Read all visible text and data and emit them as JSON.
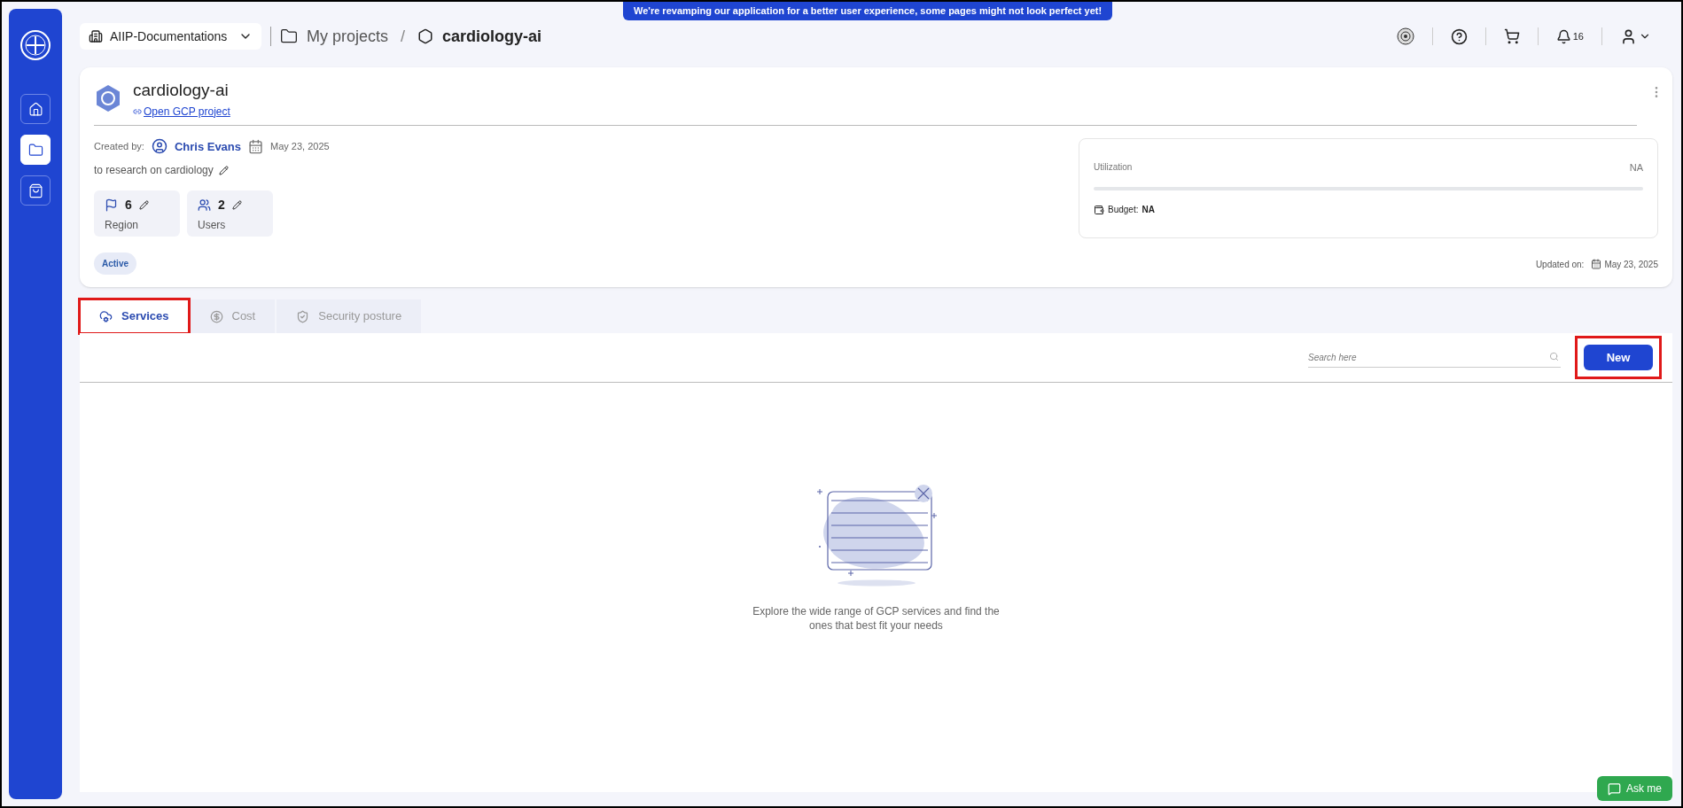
{
  "banner": "We're revamping our application for a better user experience, some pages might not look perfect yet!",
  "sidebar": {
    "items": [
      {
        "kind": "home",
        "selected": false
      },
      {
        "kind": "folder",
        "selected": true
      },
      {
        "kind": "bag",
        "selected": false
      }
    ]
  },
  "topbar": {
    "workspace": "AIIP-Documentations",
    "breadcrumb": [
      "My projects",
      "cardiology-ai"
    ],
    "separator": "/",
    "notifications": "16"
  },
  "project": {
    "name": "cardiology-ai",
    "link": "Open GCP project",
    "created_by_label": "Created by:",
    "creator": "Chris Evans",
    "created_on": "May 23, 2025",
    "description": "to research on cardiology",
    "stats": [
      {
        "kind": "region",
        "value": "6",
        "label": "Region"
      },
      {
        "kind": "users",
        "value": "2",
        "label": "Users"
      }
    ],
    "status": "Active",
    "utilization": {
      "label": "Utilization",
      "reading": "NA"
    },
    "budget": {
      "label": "Budget:",
      "value": "NA"
    },
    "updated_label": "Updated on:",
    "updated_on": "May 23, 2025"
  },
  "tabs": [
    {
      "kind": "services",
      "label": "Services",
      "selected": true,
      "highlighted": true
    },
    {
      "kind": "cost",
      "label": "Cost",
      "selected": false,
      "highlighted": false
    },
    {
      "kind": "security",
      "label": "Security posture",
      "selected": false,
      "highlighted": false
    }
  ],
  "search": {
    "placeholder": "Search here"
  },
  "new_button": {
    "label": "New",
    "highlighted": true
  },
  "empty_state": "Explore the wide range of GCP services and find the ones that best fit your needs",
  "chat_button": "Ask me"
}
